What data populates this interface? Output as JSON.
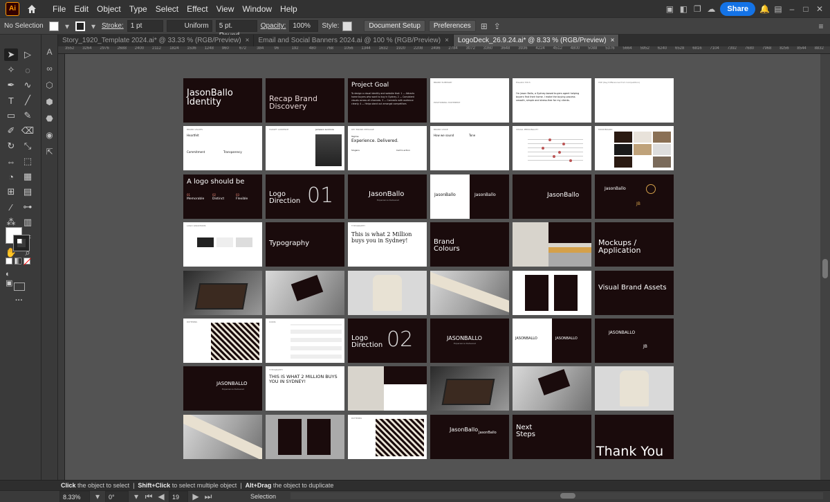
{
  "app": {
    "logo": "Ai"
  },
  "menu": [
    "File",
    "Edit",
    "Object",
    "Type",
    "Select",
    "Effect",
    "View",
    "Window",
    "Help"
  ],
  "share": "Share",
  "control": {
    "selection": "No Selection",
    "stroke_label": "Stroke:",
    "stroke_value": "1 pt",
    "uniform": "Uniform",
    "brush": "5 pt. Round",
    "opacity_label": "Opacity:",
    "opacity_value": "100%",
    "style_label": "Style:",
    "doc_setup": "Document Setup",
    "preferences": "Preferences"
  },
  "tabs": [
    {
      "label": "Story_1920_Template 2024.ai* @ 33.33 % (RGB/Preview)",
      "active": false
    },
    {
      "label": "Email and Social Banners 2024.ai @ 100 % (RGB/Preview)",
      "active": false
    },
    {
      "label": "LogoDeck_26.9.24.ai* @ 8.33 % (RGB/Preview)",
      "active": true
    }
  ],
  "ruler": [
    "3552",
    "3264",
    "2976",
    "2688",
    "2400",
    "2112",
    "1824",
    "1536",
    "1248",
    "960",
    "672",
    "384",
    "96",
    "192",
    "480",
    "768",
    "1056",
    "1344",
    "1632",
    "1920",
    "2208",
    "2496",
    "2784",
    "3072",
    "3360",
    "3648",
    "3936",
    "4224",
    "4512",
    "4800",
    "5088",
    "5376",
    "5664",
    "5952",
    "6240",
    "6528",
    "6816",
    "7104",
    "7392",
    "7680",
    "7968",
    "8256",
    "8544",
    "8832"
  ],
  "slides": {
    "s1": {
      "title": "JasonBallo Identity"
    },
    "s2": {
      "title": "Recap Brand Discovery"
    },
    "s3": {
      "title": "Project Goal",
      "body": "To design a visual identity and website that: 1 — Attracts home buyers who want to buy in Sydney. 2 — Consistent visuals across all channels. 3 — Connects with audience clearly. 4 — Helps stand out amongst competitors"
    },
    "s4": {
      "head": "BRAND SUMMARY",
      "head2": "POSITIONING STATEMENT"
    },
    "s5": {
      "head": "Elevator Pitch",
      "body": "I'm Jason Ballo, a Sydney-based buyers agent helping buyers find their home. I make the buying process smooth, simple and stress-free for my clients."
    },
    "s6": {
      "head": "USP (Key Differences from Competition)"
    },
    "s7": {
      "head": "BRAND VALUES",
      "a": "Heartfelt",
      "b": "Commitment",
      "c": "Transparency"
    },
    "s8": {
      "head": "TARGET AUDIENCE",
      "name": "Jameson Luxmore"
    },
    "s9": {
      "head": "KEY BRAND MESSAGE",
      "tag": "Tagline",
      "big": "Experience. Delivered.",
      "slogan": "Slogans",
      "cta": "Call to action"
    },
    "s10": {
      "head": "BRAND VOICE",
      "a": "How we sound",
      "b": "Tone"
    },
    "s11": {
      "head": "VISUAL PERSONALITY"
    },
    "s12": {
      "head": "MOODBOARD"
    },
    "s13": {
      "title": "A logo should be",
      "a": "01",
      "b": "02",
      "c": "03",
      "la": "Memorable",
      "lb": "Distinct",
      "lc": "Flexible"
    },
    "s14": {
      "title": "Logo Direction",
      "num": "01"
    },
    "s15": {
      "logo": "JasonBallo",
      "sub": "Experience Delivered"
    },
    "s16": {
      "logo": "JasonBallo"
    },
    "s17": {
      "logo": "JasonBallo"
    },
    "s18": {
      "logo": "JasonBallo",
      "mono": "JB"
    },
    "s19": {
      "head": "LOGO VARIATIONS"
    },
    "s20": {
      "title": "Typography"
    },
    "s21": {
      "head": "TYPOGRAPHY",
      "big": "This is what 2 Million buys you in Sydney!"
    },
    "s22": {
      "title": "Brand Colours"
    },
    "s24": {
      "title": "Mockups / Application"
    },
    "s30": {
      "title": "Visual Brand Assets"
    },
    "s31": {
      "head": "PATTERNS"
    },
    "s32": {
      "head": "ICONS"
    },
    "s33": {
      "title": "Logo Direction",
      "num": "02"
    },
    "s34": {
      "logo": "JASONBALLO",
      "sub": "Experience Delivered"
    },
    "s35": {
      "logo": "JASONBALLO"
    },
    "s36": {
      "logo": "JASONBALLO",
      "mono": "JB"
    },
    "s37": {
      "logo": "JASONBALLO",
      "sub": "Experience Delivered"
    },
    "s38": {
      "head": "TYPOGRAPHY",
      "big": "THIS IS WHAT 2 MILLION BUYS YOU IN SYDNEY!"
    },
    "s47": {
      "title": "Next Steps"
    },
    "s48": {
      "title": "Thank You"
    }
  },
  "status": {
    "hint1": "Click",
    "hint1b": "the object to select",
    "hint2": "Shift+Click",
    "hint2b": "to select multiple object",
    "hint3": "Alt+Drag",
    "hint3b": "the object to duplicate"
  },
  "bottom": {
    "zoom": "8.33%",
    "rotate": "0°",
    "artboard": "19",
    "mode": "Selection"
  }
}
